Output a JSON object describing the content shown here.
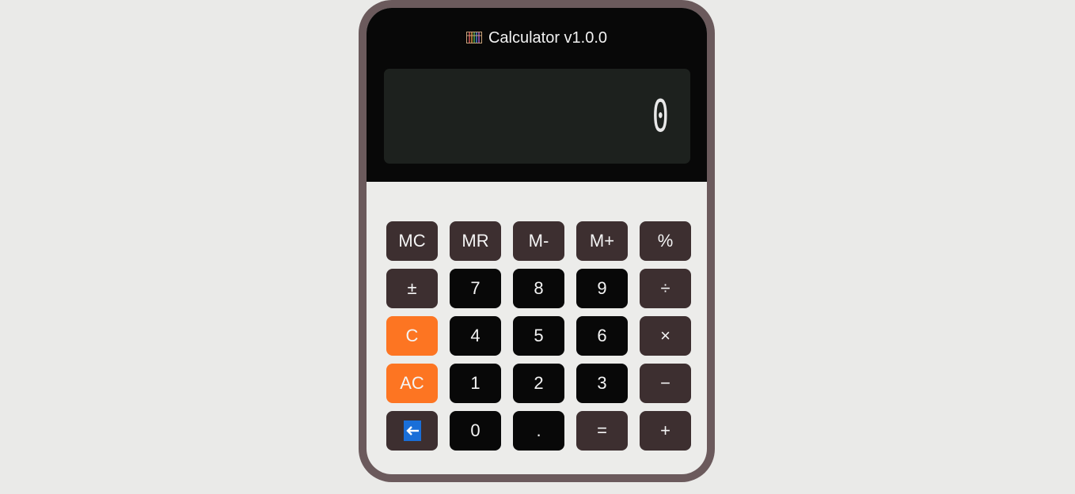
{
  "app": {
    "title": "Calculator v1.0.0",
    "title_icon": "abacus-icon"
  },
  "display": {
    "value": "0"
  },
  "colors": {
    "frame": "#6b5a5c",
    "top_panel": "#080808",
    "display_bg": "#1d211e",
    "function_key": "#3d2f30",
    "number_key": "#080808",
    "clear_key": "#fd7522",
    "backspace_icon": "#1a6fd8"
  },
  "keys": {
    "mc": "MC",
    "mr": "MR",
    "m_minus": "M-",
    "m_plus": "M+",
    "percent": "%",
    "plus_minus": "±",
    "seven": "7",
    "eight": "8",
    "nine": "9",
    "divide": "÷",
    "clear": "C",
    "four": "4",
    "five": "5",
    "six": "6",
    "multiply": "×",
    "all_clear": "AC",
    "one": "1",
    "two": "2",
    "three": "3",
    "subtract": "−",
    "backspace_icon": "backspace-arrow-icon",
    "zero": "0",
    "decimal": ".",
    "equals": "=",
    "add": "+"
  }
}
